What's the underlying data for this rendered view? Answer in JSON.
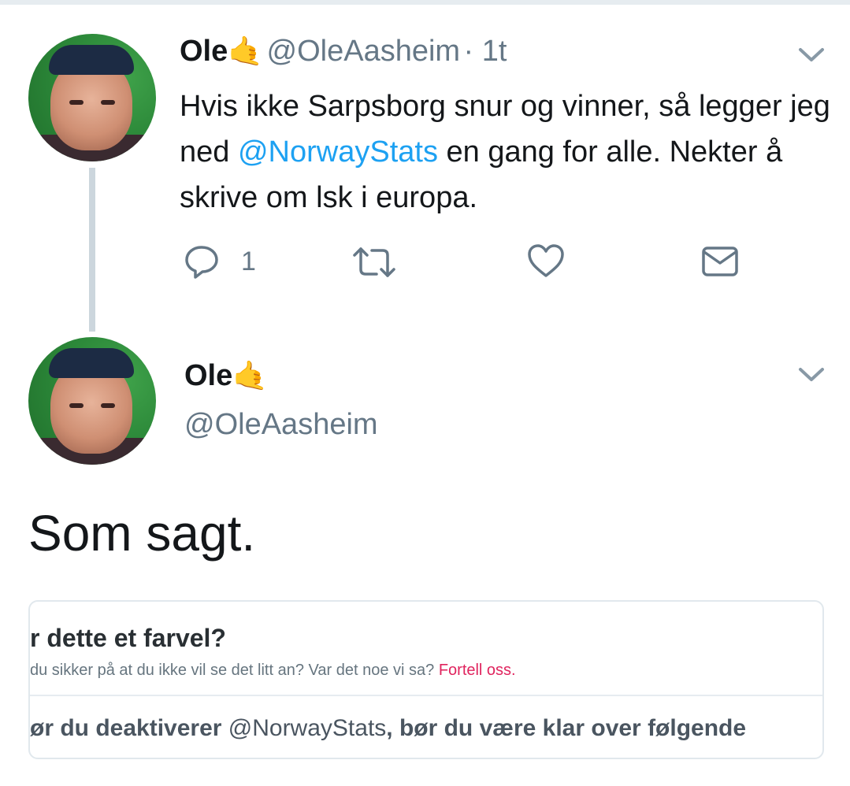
{
  "tweet1": {
    "name": "Ole",
    "emoji": "🤙",
    "handle": "@OleAasheim",
    "time": "· 1t",
    "text_part1": "Hvis ikke Sarpsborg snur og vinner, så legger jeg ned ",
    "mention": "@NorwayStats",
    "text_part2": " en gang for alle. Nekter å skrive om lsk i europa.",
    "reply_count": "1"
  },
  "tweet2": {
    "name": "Ole",
    "emoji": "🤙",
    "handle": "@OleAasheim",
    "text": "Som sagt."
  },
  "card": {
    "title": "r dette et farvel?",
    "subtitle": " du sikker på at du ikke vil se det litt an? Var det noe vi sa? ",
    "link": "Fortell oss.",
    "bottom_bold1": "ør du deaktiverer ",
    "bottom_handle": "@NorwayStats",
    "bottom_bold2": ", bør du være klar over følgende"
  },
  "colors": {
    "link_blue": "#1da1f2",
    "handle_gray": "#657786",
    "thread_line": "#ccd6dd",
    "card_link_red": "#e0245e"
  },
  "icons": [
    "reply-icon",
    "retweet-icon",
    "like-icon",
    "direct-message-icon",
    "chevron-down-icon"
  ]
}
